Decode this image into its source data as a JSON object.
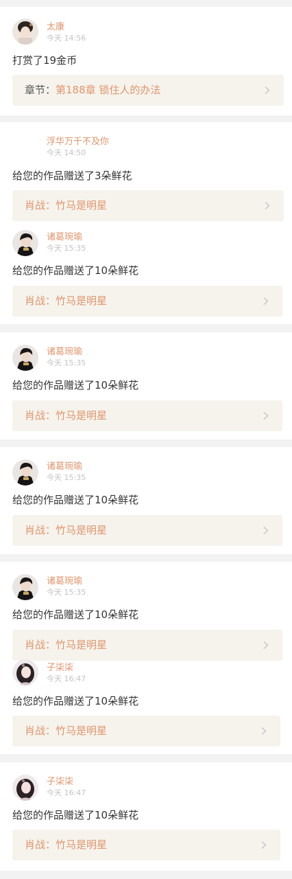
{
  "cards": [
    {
      "entries": [
        {
          "user": "太康",
          "time": "今天 14:56",
          "message": "打赏了19金币",
          "link_prefix": "章节：",
          "link_text": "第188章 锁住人的办法",
          "avatar": "avatar-woman-traditional"
        }
      ]
    },
    {
      "entries": [
        {
          "user": "浮华万千不及你",
          "time": "今天 14:50",
          "message": "给您的作品赠送了3朵鲜花",
          "link_text": "肖战：竹马是明星",
          "avatar": ""
        },
        {
          "user": "诸葛琬瑜",
          "time": "今天 15:35",
          "message": "给您的作品赠送了10朵鲜花",
          "link_text": "肖战：竹马是明星",
          "avatar": "avatar-man-dark"
        }
      ]
    },
    {
      "entries": [
        {
          "user": "诸葛琬瑜",
          "time": "今天 15:35",
          "message": "给您的作品赠送了10朵鲜花",
          "link_text": "肖战：竹马是明星",
          "avatar": "avatar-man-dark"
        }
      ]
    },
    {
      "entries": [
        {
          "user": "诸葛琬瑜",
          "time": "今天 15:35",
          "message": "给您的作品赠送了10朵鲜花",
          "link_text": "肖战：竹马是明星",
          "avatar": "avatar-man-dark"
        }
      ]
    },
    {
      "entries": [
        {
          "user": "诸葛琬瑜",
          "time": "今天 15:35",
          "message": "给您的作品赠送了10朵鲜花",
          "link_text": "肖战：竹马是明星",
          "avatar": "avatar-man-dark"
        },
        {
          "user": "子柒柒",
          "time": "今天 16:47",
          "message": "给您的作品赠送了10朵鲜花",
          "link_text": "肖战：竹马是明星",
          "avatar": "avatar-girl"
        }
      ]
    },
    {
      "entries": [
        {
          "user": "子柒柒",
          "time": "今天 16:47",
          "message": "给您的作品赠送了10朵鲜花",
          "link_text": "肖战：竹马是明星",
          "avatar": "avatar-girl"
        }
      ]
    }
  ],
  "colors": {
    "background": "#f2f2f2",
    "card": "#ffffff",
    "accent": "#e0956d",
    "text": "#333333",
    "muted": "#c2c2c2",
    "link_bg": "#f5f3ec"
  }
}
